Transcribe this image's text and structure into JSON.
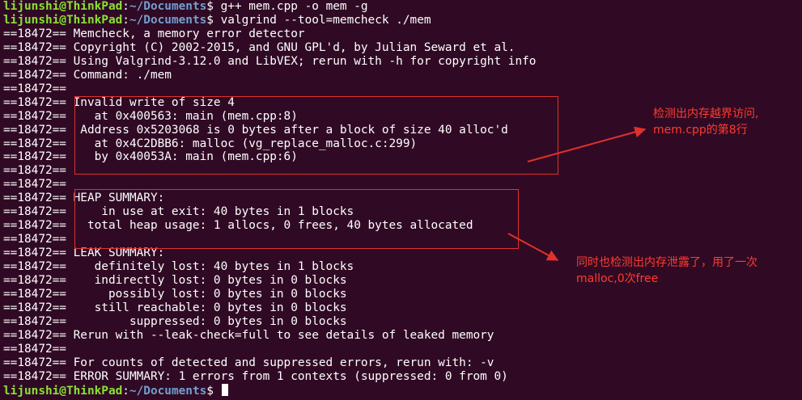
{
  "prompt": {
    "user": "lijunshi@ThinkPad",
    "path": "~/Documents"
  },
  "lines": [
    {
      "prompt": true,
      "text": " g++ mem.cpp -o mem -g"
    },
    {
      "prompt": true,
      "text": " valgrind --tool=memcheck ./mem"
    },
    {
      "text": "==18472== Memcheck, a memory error detector"
    },
    {
      "text": "==18472== Copyright (C) 2002-2015, and GNU GPL'd, by Julian Seward et al."
    },
    {
      "text": "==18472== Using Valgrind-3.12.0 and LibVEX; rerun with -h for copyright info"
    },
    {
      "text": "==18472== Command: ./mem"
    },
    {
      "text": "==18472=="
    },
    {
      "text": "==18472== Invalid write of size 4"
    },
    {
      "text": "==18472==    at 0x400563: main (mem.cpp:8)"
    },
    {
      "text": "==18472==  Address 0x5203068 is 0 bytes after a block of size 40 alloc'd"
    },
    {
      "text": "==18472==    at 0x4C2DBB6: malloc (vg_replace_malloc.c:299)"
    },
    {
      "text": "==18472==    by 0x40053A: main (mem.cpp:6)"
    },
    {
      "text": "==18472=="
    },
    {
      "text": "==18472=="
    },
    {
      "text": "==18472== HEAP SUMMARY:"
    },
    {
      "text": "==18472==     in use at exit: 40 bytes in 1 blocks"
    },
    {
      "text": "==18472==   total heap usage: 1 allocs, 0 frees, 40 bytes allocated"
    },
    {
      "text": "==18472=="
    },
    {
      "text": "==18472== LEAK SUMMARY:"
    },
    {
      "text": "==18472==    definitely lost: 40 bytes in 1 blocks"
    },
    {
      "text": "==18472==    indirectly lost: 0 bytes in 0 blocks"
    },
    {
      "text": "==18472==      possibly lost: 0 bytes in 0 blocks"
    },
    {
      "text": "==18472==    still reachable: 0 bytes in 0 blocks"
    },
    {
      "text": "==18472==         suppressed: 0 bytes in 0 blocks"
    },
    {
      "text": "==18472== Rerun with --leak-check=full to see details of leaked memory"
    },
    {
      "text": "==18472=="
    },
    {
      "text": "==18472== For counts of detected and suppressed errors, rerun with: -v"
    },
    {
      "text": "==18472== ERROR SUMMARY: 1 errors from 1 contexts (suppressed: 0 from 0)"
    },
    {
      "prompt": true,
      "text": " ",
      "cursor": true
    }
  ],
  "annotations": {
    "note1": "检测出内存越界访问,\nmem.cpp的第8行",
    "note2": "同时也检测出内存泄露了，用了一次\nmalloc,0次free"
  },
  "colors": {
    "background": "#300a24",
    "text": "#ffffff",
    "prompt_user": "#8ae234",
    "prompt_path": "#729fcf",
    "annotation": "#e0312c"
  }
}
